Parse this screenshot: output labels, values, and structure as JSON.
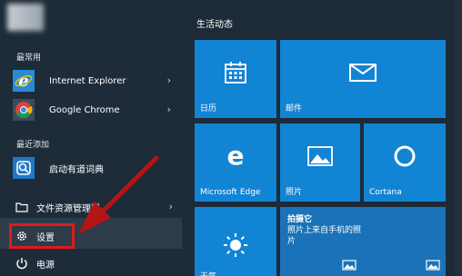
{
  "left": {
    "most_used_label": "最常用",
    "most_used": [
      {
        "name": "Internet Explorer",
        "icon": "internet-explorer-icon"
      },
      {
        "name": "Google Chrome",
        "icon": "google-chrome-icon"
      }
    ],
    "recently_added_label": "最近添加",
    "recently_added": [
      {
        "name": "启动有道词典",
        "icon": "youdao-dict-icon"
      }
    ],
    "system": {
      "file_explorer": "文件资源管理器",
      "settings": "设置",
      "power": "电源"
    }
  },
  "tiles": {
    "group_title": "生活动态",
    "calendar": "日历",
    "mail": "邮件",
    "edge": "Microsoft Edge",
    "photos": "照片",
    "cortana": "Cortana",
    "photo_promo_title": "拍摄它",
    "photo_promo_body": "照片上来自手机的照片",
    "weather": "天气"
  },
  "colors": {
    "tile_blue": "#1284d4",
    "highlight_red": "#e01a1a",
    "menu_bg": "#1e2c3a"
  }
}
